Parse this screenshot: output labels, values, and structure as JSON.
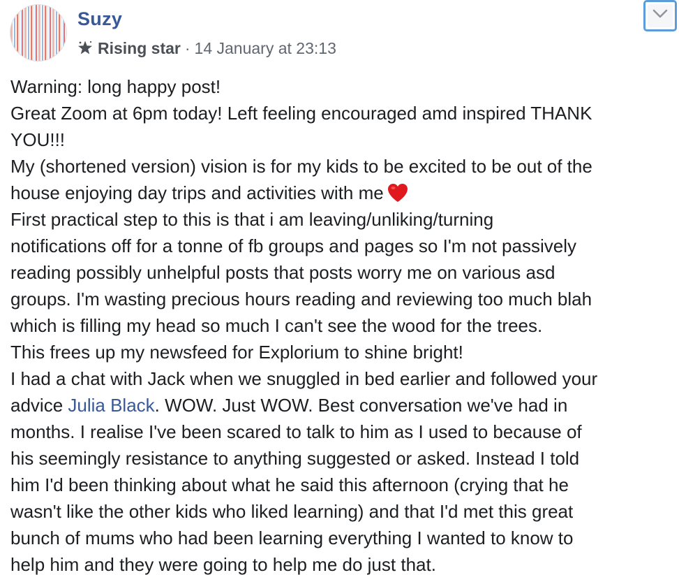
{
  "post": {
    "author": "Suzy",
    "badge": "Rising star",
    "separator": "·",
    "timestamp": "14 January at 23:13",
    "icons": {
      "avatar": "profile-picture",
      "badge": "star-badge-icon",
      "options": "chevron-down-icon",
      "emoji": "red-heart-emoji"
    },
    "colors": {
      "author": "#385898",
      "mention": "#385898",
      "text": "#1c1e21",
      "meta": "#606770",
      "focus_ring": "#5b9dd9",
      "heart": "#e0191f"
    },
    "lines": [
      "Warning: long happy post!",
      "Great Zoom at 6pm today! Left feeling encouraged amd inspired THANK",
      "YOU!!!",
      "My (shortened version) vision is for my kids to be excited to be out of the",
      "house enjoying day trips and activities with me",
      "First practical step to this is that i am leaving/unliking/turning",
      "notifications off for a tonne of fb groups and pages so I'm not passively",
      "reading possibly unhelpful posts that posts worry me on various asd",
      "groups. I'm wasting precious hours reading and reviewing too much blah",
      "which is filling my head so much I can't see the wood for the trees.",
      "This frees up my newsfeed for Explorium to shine bright!",
      "I had a chat with Jack when we snuggled in bed earlier and followed your",
      "advice",
      "Julia Black",
      ". WOW. Just WOW. Best conversation we've had in",
      "months. I realise I've been scared to talk to him as I used to because of",
      "his seemingly resistance to anything suggested or asked. Instead I told",
      "him I'd been thinking about what he said this afternoon (crying that he",
      "wasn't like the other kids who liked learning) and that I'd met this great",
      "bunch of mums who had been learning everything I wanted to know to",
      "help him and they were going to help me do just that."
    ]
  }
}
